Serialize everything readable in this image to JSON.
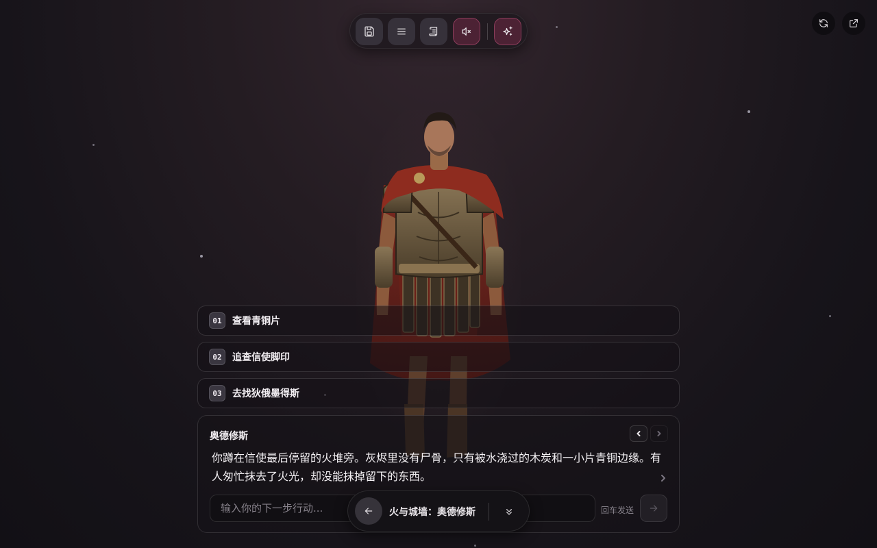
{
  "toolbar": {
    "buttons": [
      {
        "name": "save",
        "icon": "save-icon"
      },
      {
        "name": "menu",
        "icon": "menu-icon"
      },
      {
        "name": "log",
        "icon": "scroll-icon"
      },
      {
        "name": "sound",
        "icon": "mute-icon"
      },
      {
        "name": "magic",
        "icon": "sparkles-icon"
      }
    ],
    "accent_color": "#8a3c5a"
  },
  "corner": {
    "refresh_icon": "refresh-icon",
    "external_icon": "external-link-icon"
  },
  "choices": [
    {
      "num": "01",
      "label": "查看青铜片"
    },
    {
      "num": "02",
      "label": "追查信使脚印"
    },
    {
      "num": "03",
      "label": "去找狄俄墨得斯"
    }
  ],
  "dialogue": {
    "speaker": "奥德修斯",
    "text": "你蹲在信使最后停留的火堆旁。灰烬里没有尸骨，只有被水浇过的木炭和一小片青铜边缘。有人匆忙抹去了火光，却没能抹掉留下的东西。"
  },
  "input": {
    "placeholder": "输入你的下一步行动...",
    "hint": "回车发送"
  },
  "story_pill": {
    "title": "火与城墙：奥德修斯"
  }
}
